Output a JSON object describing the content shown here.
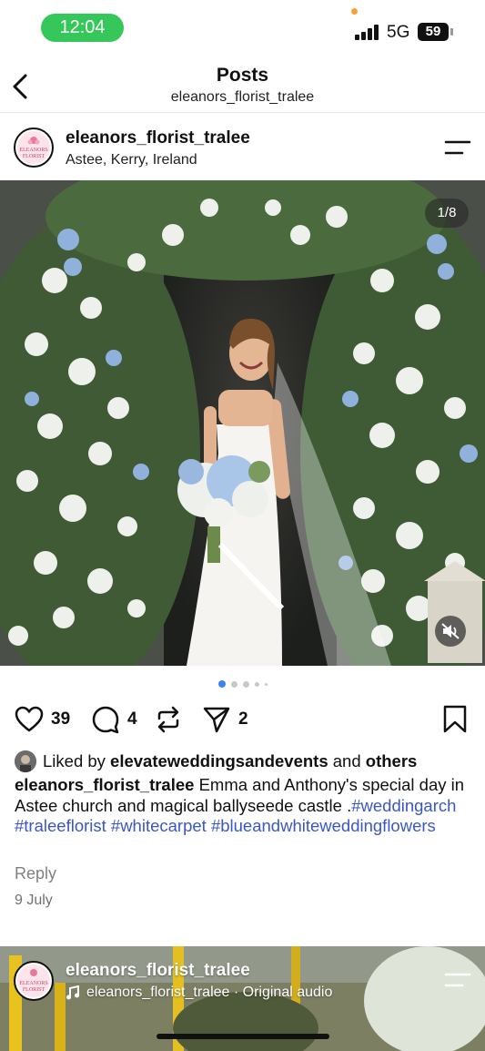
{
  "status_bar": {
    "time": "12:04",
    "network": "5G",
    "battery": "59"
  },
  "nav": {
    "title": "Posts",
    "subtitle": "eleanors_florist_tralee",
    "back_icon": "chevron-left-icon"
  },
  "post": {
    "username": "eleanors_florist_tralee",
    "location": "Astee, Kerry, Ireland",
    "avatar_text": "ELEANORS FLORIST",
    "image_counter": "1/8",
    "image_description_icon": "mute-icon",
    "carousel": {
      "total_visible_dots": 5,
      "active_index": 0
    },
    "likes_count": "39",
    "comments_count": "4",
    "shares_count": "2",
    "liked_by_prefix": "Liked by",
    "liked_by_user": "elevateweddingsandevents",
    "liked_by_and": "and",
    "liked_by_others": "others",
    "caption_user": "eleanors_florist_tralee",
    "caption_text": "Emma and Anthony's special day in Astee church and magical ballyseede castle .",
    "hashtags": [
      "#weddingarch",
      "#traleeflorist",
      "#whitecarpet",
      "#blueandwhiteweddingflowers"
    ],
    "reply_label": "Reply",
    "date": "9 July"
  },
  "next_post": {
    "username": "eleanors_florist_tralee",
    "audio": "eleanors_florist_tralee · Original audio"
  },
  "colors": {
    "accent_blue": "#3b56c7",
    "status_green": "#35c759",
    "active_dot": "#3b82f6"
  }
}
